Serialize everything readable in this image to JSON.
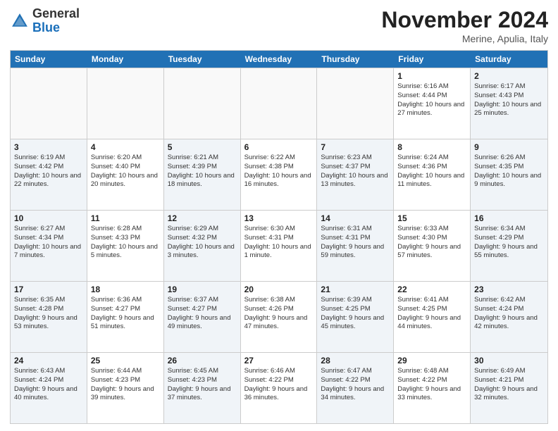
{
  "logo": {
    "general": "General",
    "blue": "Blue"
  },
  "title": "November 2024",
  "subtitle": "Merine, Apulia, Italy",
  "days_of_week": [
    "Sunday",
    "Monday",
    "Tuesday",
    "Wednesday",
    "Thursday",
    "Friday",
    "Saturday"
  ],
  "weeks": [
    [
      {
        "day": "",
        "info": "",
        "empty": true
      },
      {
        "day": "",
        "info": "",
        "empty": true
      },
      {
        "day": "",
        "info": "",
        "empty": true
      },
      {
        "day": "",
        "info": "",
        "empty": true
      },
      {
        "day": "",
        "info": "",
        "empty": true
      },
      {
        "day": "1",
        "info": "Sunrise: 6:16 AM\nSunset: 4:44 PM\nDaylight: 10 hours and 27 minutes.",
        "empty": false
      },
      {
        "day": "2",
        "info": "Sunrise: 6:17 AM\nSunset: 4:43 PM\nDaylight: 10 hours and 25 minutes.",
        "empty": false
      }
    ],
    [
      {
        "day": "3",
        "info": "Sunrise: 6:19 AM\nSunset: 4:42 PM\nDaylight: 10 hours and 22 minutes.",
        "empty": false
      },
      {
        "day": "4",
        "info": "Sunrise: 6:20 AM\nSunset: 4:40 PM\nDaylight: 10 hours and 20 minutes.",
        "empty": false
      },
      {
        "day": "5",
        "info": "Sunrise: 6:21 AM\nSunset: 4:39 PM\nDaylight: 10 hours and 18 minutes.",
        "empty": false
      },
      {
        "day": "6",
        "info": "Sunrise: 6:22 AM\nSunset: 4:38 PM\nDaylight: 10 hours and 16 minutes.",
        "empty": false
      },
      {
        "day": "7",
        "info": "Sunrise: 6:23 AM\nSunset: 4:37 PM\nDaylight: 10 hours and 13 minutes.",
        "empty": false
      },
      {
        "day": "8",
        "info": "Sunrise: 6:24 AM\nSunset: 4:36 PM\nDaylight: 10 hours and 11 minutes.",
        "empty": false
      },
      {
        "day": "9",
        "info": "Sunrise: 6:26 AM\nSunset: 4:35 PM\nDaylight: 10 hours and 9 minutes.",
        "empty": false
      }
    ],
    [
      {
        "day": "10",
        "info": "Sunrise: 6:27 AM\nSunset: 4:34 PM\nDaylight: 10 hours and 7 minutes.",
        "empty": false
      },
      {
        "day": "11",
        "info": "Sunrise: 6:28 AM\nSunset: 4:33 PM\nDaylight: 10 hours and 5 minutes.",
        "empty": false
      },
      {
        "day": "12",
        "info": "Sunrise: 6:29 AM\nSunset: 4:32 PM\nDaylight: 10 hours and 3 minutes.",
        "empty": false
      },
      {
        "day": "13",
        "info": "Sunrise: 6:30 AM\nSunset: 4:31 PM\nDaylight: 10 hours and 1 minute.",
        "empty": false
      },
      {
        "day": "14",
        "info": "Sunrise: 6:31 AM\nSunset: 4:31 PM\nDaylight: 9 hours and 59 minutes.",
        "empty": false
      },
      {
        "day": "15",
        "info": "Sunrise: 6:33 AM\nSunset: 4:30 PM\nDaylight: 9 hours and 57 minutes.",
        "empty": false
      },
      {
        "day": "16",
        "info": "Sunrise: 6:34 AM\nSunset: 4:29 PM\nDaylight: 9 hours and 55 minutes.",
        "empty": false
      }
    ],
    [
      {
        "day": "17",
        "info": "Sunrise: 6:35 AM\nSunset: 4:28 PM\nDaylight: 9 hours and 53 minutes.",
        "empty": false
      },
      {
        "day": "18",
        "info": "Sunrise: 6:36 AM\nSunset: 4:27 PM\nDaylight: 9 hours and 51 minutes.",
        "empty": false
      },
      {
        "day": "19",
        "info": "Sunrise: 6:37 AM\nSunset: 4:27 PM\nDaylight: 9 hours and 49 minutes.",
        "empty": false
      },
      {
        "day": "20",
        "info": "Sunrise: 6:38 AM\nSunset: 4:26 PM\nDaylight: 9 hours and 47 minutes.",
        "empty": false
      },
      {
        "day": "21",
        "info": "Sunrise: 6:39 AM\nSunset: 4:25 PM\nDaylight: 9 hours and 45 minutes.",
        "empty": false
      },
      {
        "day": "22",
        "info": "Sunrise: 6:41 AM\nSunset: 4:25 PM\nDaylight: 9 hours and 44 minutes.",
        "empty": false
      },
      {
        "day": "23",
        "info": "Sunrise: 6:42 AM\nSunset: 4:24 PM\nDaylight: 9 hours and 42 minutes.",
        "empty": false
      }
    ],
    [
      {
        "day": "24",
        "info": "Sunrise: 6:43 AM\nSunset: 4:24 PM\nDaylight: 9 hours and 40 minutes.",
        "empty": false
      },
      {
        "day": "25",
        "info": "Sunrise: 6:44 AM\nSunset: 4:23 PM\nDaylight: 9 hours and 39 minutes.",
        "empty": false
      },
      {
        "day": "26",
        "info": "Sunrise: 6:45 AM\nSunset: 4:23 PM\nDaylight: 9 hours and 37 minutes.",
        "empty": false
      },
      {
        "day": "27",
        "info": "Sunrise: 6:46 AM\nSunset: 4:22 PM\nDaylight: 9 hours and 36 minutes.",
        "empty": false
      },
      {
        "day": "28",
        "info": "Sunrise: 6:47 AM\nSunset: 4:22 PM\nDaylight: 9 hours and 34 minutes.",
        "empty": false
      },
      {
        "day": "29",
        "info": "Sunrise: 6:48 AM\nSunset: 4:22 PM\nDaylight: 9 hours and 33 minutes.",
        "empty": false
      },
      {
        "day": "30",
        "info": "Sunrise: 6:49 AM\nSunset: 4:21 PM\nDaylight: 9 hours and 32 minutes.",
        "empty": false
      }
    ]
  ]
}
